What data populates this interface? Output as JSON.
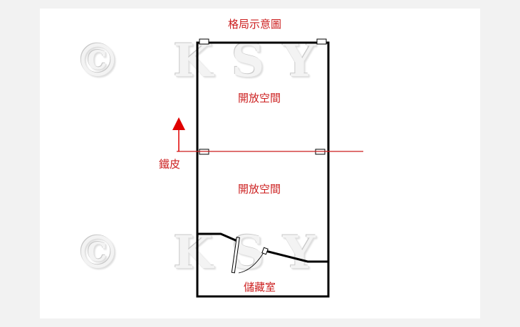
{
  "diagram": {
    "title": "格局示意圖",
    "rooms": {
      "upper": "開放空間",
      "lower": "開放空間",
      "storage": "儲藏室"
    },
    "marker_label": "鐵皮",
    "watermark": "© KSY",
    "colors": {
      "text": "#cc1f1f",
      "wall": "#000000",
      "divider": "#cc1f1f",
      "arrow": "#e00000"
    }
  }
}
